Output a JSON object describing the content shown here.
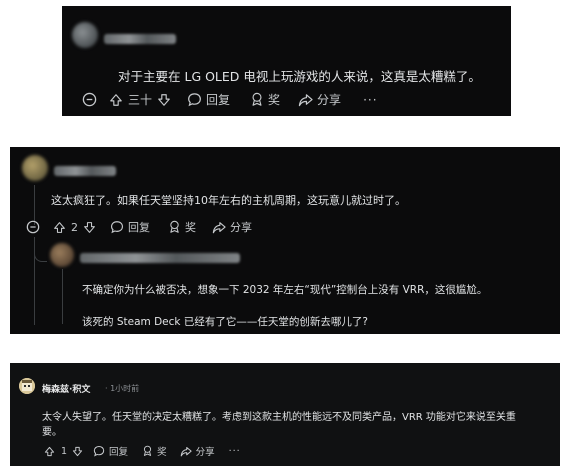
{
  "comment1": {
    "text": "对于主要在 LG OLED 电视上玩游戏的人来说，这真是太糟糕了。",
    "votes": "三十",
    "reply_label": "回复",
    "award_label": "奖",
    "share_label": "分享",
    "more_label": "···"
  },
  "comment2": {
    "text": "这太疯狂了。如果任天堂坚持10年左右的主机周期，这玩意儿就过时了。",
    "votes": "2",
    "reply_label": "回复",
    "award_label": "奖",
    "share_label": "分享",
    "reply": {
      "line1": "不确定你为什么被否决，想象一下 2032 年左右“现代”控制台上没有 VRR，这很尴尬。",
      "line2": "该死的 Steam Deck 已经有了它——任天堂的创新去哪儿了?"
    }
  },
  "comment3": {
    "username": "梅森兹·积文",
    "time": "· 1小时前",
    "line1": "太令人失望了。任天堂的决定太糟糕了。考虑到这款主机的性能远不及同类产品，VRR 功能对它来说至关重",
    "line2": "要。",
    "votes": "1",
    "reply_label": "回复",
    "award_label": "奖",
    "share_label": "分享",
    "more_label": "···"
  }
}
